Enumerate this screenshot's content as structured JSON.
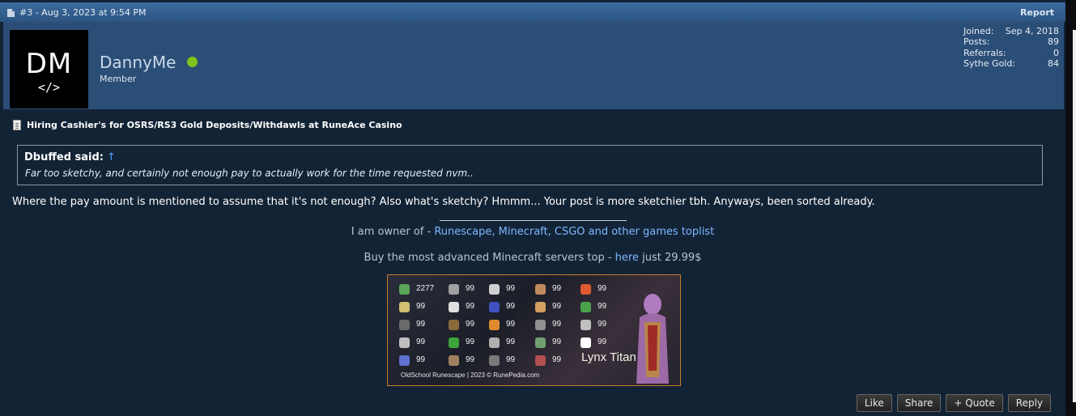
{
  "post": {
    "meta": "#3 - Aug 3, 2023 at 9:54 PM",
    "report_label": "Report"
  },
  "user": {
    "avatar_initials": "DM",
    "avatar_code": "</>",
    "name": "DannyMe",
    "title": "Member",
    "online_color": "#7fc21b",
    "stats": [
      {
        "label": "Joined:",
        "value": "Sep 4, 2018"
      },
      {
        "label": "Posts:",
        "value": "89"
      },
      {
        "label": "Referrals:",
        "value": "0"
      },
      {
        "label": "Sythe Gold:",
        "value": "84"
      }
    ]
  },
  "thread_title": "Hiring Cashier's for OSRS/RS3 Gold Deposits/Withdawls at RuneAce Casino",
  "quote": {
    "author": "Dbuffed said:",
    "arrow": "↑",
    "text": "Far too sketchy, and certainly not enough pay to actually work for the time requested nvm.."
  },
  "message": "Where the pay amount is mentioned to assume that it's not enough? Also what's sketchy? Hmmm... Your post is more sketchier tbh. Anyways, been sorted already.",
  "signature": {
    "line1_prefix": "I am owner of - ",
    "line1_link": "Runescape, Minecraft, CSGO and other games toplist",
    "line2_prefix": "Buy the most advanced Minecraft servers top - ",
    "line2_link": "here",
    "line2_suffix": " just 29.99$",
    "stats_image": {
      "total": "2277",
      "levels": [
        "99",
        "99",
        "99",
        "99",
        "99",
        "99",
        "99",
        "99",
        "99",
        "99",
        "99",
        "99",
        "99",
        "99",
        "99",
        "99",
        "99",
        "99",
        "99",
        "99",
        "99",
        "99",
        "99"
      ],
      "player": "Lynx Titan",
      "credit": "OldSchool Runescape | 2023 © RunePedia.com"
    }
  },
  "buttons": {
    "like": "Like",
    "share": "Share",
    "quote": "+ Quote",
    "reply": "Reply"
  },
  "colors": {
    "header_blue": "#3d6a9e",
    "user_bar": "#2b4e77",
    "post_bg": "#132336",
    "link": "#7cb8ff"
  }
}
